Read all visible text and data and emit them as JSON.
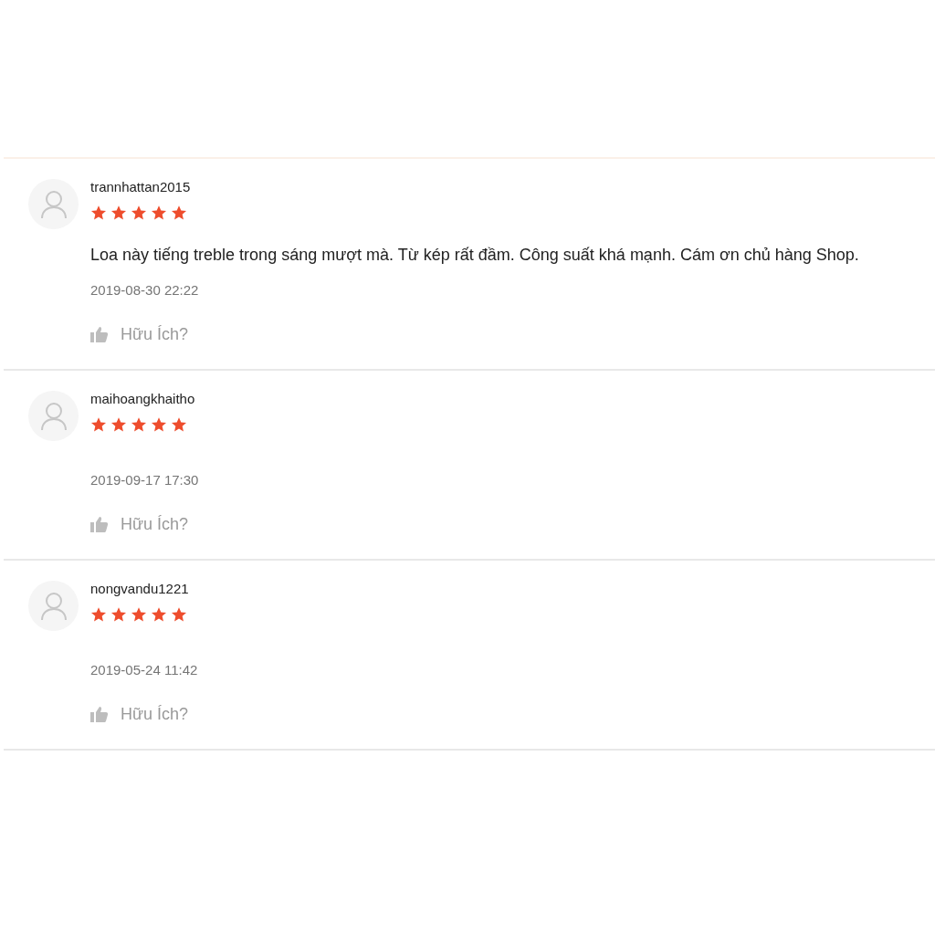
{
  "reviews": [
    {
      "author": "trannhattan2015",
      "stars": 5,
      "comment": "Loa này tiếng treble trong sáng mượt mà. Từ kép rất đầm. Công suất khá mạnh. Cám ơn chủ hàng Shop.",
      "date": "2019-08-30 22:22",
      "helpful_label": "Hữu Ích?"
    },
    {
      "author": "maihoangkhaitho",
      "stars": 5,
      "date": "2019-09-17 17:30",
      "helpful_label": "Hữu Ích?"
    },
    {
      "author": "nongvandu1221",
      "stars": 5,
      "date": "2019-05-24 11:42",
      "helpful_label": "Hữu Ích?"
    }
  ]
}
